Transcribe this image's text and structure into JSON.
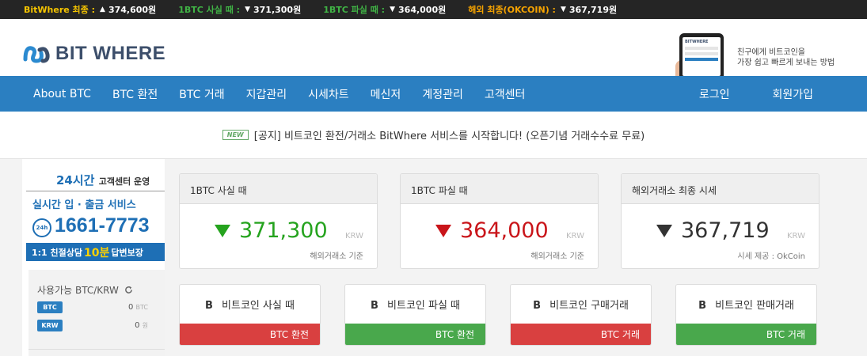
{
  "ticker": [
    {
      "label": "BitWhere 최종 :",
      "arrow": "▲",
      "value": "374,600원",
      "color": "#f5c400"
    },
    {
      "label": "1BTC 사실 때 :",
      "arrow": "▼",
      "value": "371,300원",
      "color": "#40b345"
    },
    {
      "label": "1BTC 파실 때 :",
      "arrow": "▼",
      "value": "364,000원",
      "color": "#40b345"
    },
    {
      "label": "해외 최종(OKCOIN) :",
      "arrow": "▼",
      "value": "367,719원",
      "color": "#f5a300"
    }
  ],
  "header": {
    "logo_text": "BIT WHERE",
    "logo_icon": "bitwhere-logo-icon",
    "phone_logo": "BITWHERE",
    "promo_line1": "친구에게 비트코인을",
    "promo_line2": "가장 쉽고 빠르게 보내는 방법"
  },
  "nav": {
    "items": [
      "About BTC",
      "BTC 환전",
      "BTC 거래",
      "지갑관리",
      "시세차트",
      "메신저",
      "계정관리",
      "고객센터"
    ],
    "login": "로그인",
    "signup": "회원가입"
  },
  "notice": {
    "badge": "NEW",
    "text": "[공지] 비트코인 환전/거래소 BitWhere 서비스를 시작합니다! (오픈기념 거래수수료 무료)"
  },
  "sidebar": {
    "cs_title": "24시간",
    "cs_title_suffix": "고객센터 운영",
    "cs_service": "실시간 입 · 출금 서비스",
    "cs_badge": "24h",
    "cs_phone": "1661-7773",
    "cs_bottom_pre": "1:1 친절상담",
    "cs_bottom_hl": "10분",
    "cs_bottom_post": "답변보장",
    "balance_title": "사용가능 BTC/KRW",
    "refresh_icon": "refresh-icon",
    "balances": [
      {
        "currency": "BTC",
        "value": "0",
        "unit": "BTC"
      },
      {
        "currency": "KRW",
        "value": "0",
        "unit": "원"
      }
    ]
  },
  "prices": [
    {
      "title": "1BTC 사실 때",
      "arrow": "down",
      "price": "371,300",
      "color": "#25a31e",
      "unit": "KRW",
      "source": "해외거래소 기준"
    },
    {
      "title": "1BTC 파실 때",
      "arrow": "down",
      "price": "364,000",
      "color": "#c9151a",
      "unit": "KRW",
      "source": "해외거래소 기준"
    },
    {
      "title": "해외거래소 최종 시세",
      "arrow": "down",
      "price": "367,719",
      "color": "#333333",
      "unit": "KRW",
      "source": "시세 제공 : OkCoin"
    }
  ],
  "actions": [
    {
      "icon": "bitcoin-icon",
      "glyph": "B",
      "label": "비트코인 사실 때",
      "footer": "BTC 환전",
      "color": "#d94040"
    },
    {
      "icon": "bitcoin-icon",
      "glyph": "B",
      "label": "비트코인 파실 때",
      "footer": "BTC 환전",
      "color": "#49a84c"
    },
    {
      "icon": "bitcoin-icon",
      "glyph": "B",
      "label": "비트코인 구매거래",
      "footer": "BTC 거래",
      "color": "#d94040"
    },
    {
      "icon": "bitcoin-icon",
      "glyph": "B",
      "label": "비트코인 판매거래",
      "footer": "BTC 거래",
      "color": "#49a84c"
    }
  ]
}
